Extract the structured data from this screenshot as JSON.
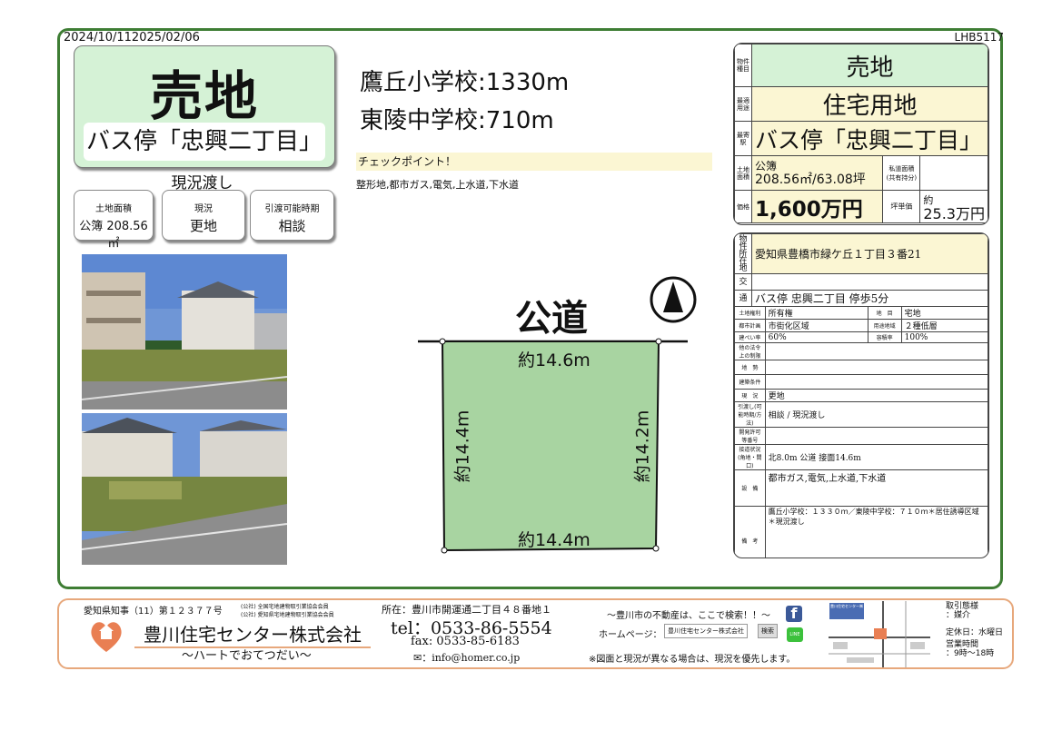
{
  "header": {
    "dates": "2024/10/112025/02/06",
    "code": "LHB5117"
  },
  "title": {
    "type": "売地",
    "bus_stop": "バス停「忠興二丁目」",
    "genkyo": "現況渡し"
  },
  "summary": [
    {
      "label": "土地面積",
      "value": "公簿 208.56㎡"
    },
    {
      "label": "現況",
      "value": "更地"
    },
    {
      "label": "引渡可能時期",
      "value": "相談"
    }
  ],
  "schools": {
    "elementary": "鷹丘小学校:1330m",
    "junior": "東陵中学校:710m"
  },
  "checkpoint": {
    "title": "チェックポイント！",
    "features": "整形地,都市ガス,電気,上水道,下水道"
  },
  "map": {
    "road": "公道",
    "top": "約14.6m",
    "left": "約14.4m",
    "right": "約14.2m",
    "bottom": "約14.4m"
  },
  "info": {
    "k1": "物件種目",
    "type": "売地",
    "k2": "最適用途",
    "use": "住宅用地",
    "k3": "最寄駅",
    "station": "バス停「忠興二丁目」",
    "k4": "土地面積",
    "area_kind": "公簿",
    "area_value": "208.56㎡/63.08坪",
    "private_road_label": "私道面積",
    "private_road_sub": "(共有持分)",
    "k5": "価格",
    "price": "1,600万円",
    "unit_price_label": "坪単価",
    "unit_price_approx": "約",
    "unit_price": "25.3万円",
    "k6": "物件所在地",
    "address": "愛知県豊橋市緑ケ丘１丁目３番21",
    "k7": "交",
    "k8": "通",
    "traffic": "バス停 忠興二丁目 停歩5分",
    "rights_label": "土地権利",
    "rights": "所有権",
    "chimoku_label": "地　目",
    "chimoku": "宅地",
    "city_label": "都市計画",
    "city": "市街化区域",
    "zone_label": "用途地域",
    "zone": "２種低層",
    "bcr_label": "建ぺい率",
    "bcr": "60%",
    "far_label": "容積率",
    "far": "100%",
    "other_law_label": "他の法令上の制限",
    "other_law": "",
    "terrain_label": "地　勢",
    "terrain": "",
    "build_label": "建築条件",
    "build": "",
    "status_label": "現　況",
    "status": "更地",
    "handover_label": "引渡し(可能時期/方法)",
    "handover": "相談 / 現況渡し",
    "dev_label": "開発許可等番号",
    "dev": "",
    "road_label": "接道状況(角地・間口)",
    "road": "北8.0m 公道 接面14.6m",
    "equip_label": "設　備",
    "equip": "都市ガス,電気,上水道,下水道",
    "remarks_label": "備　考",
    "remarks": "鷹丘小学校：１３３０ｍ／東陵中学校：７１０ｍ＊居住誘導区域＊現況渡し"
  },
  "footer": {
    "license": "愛知県知事（11）第１２３７７号",
    "assoc1": "(公社) 全国宅地建物取引業協会会員",
    "assoc2": "(公社) 愛知県宅地建物取引業協会会員",
    "company": "豊川住宅センター株式会社",
    "slogan": "～ハートでおてつだい～",
    "address": "所在：豊川市開運通二丁目４８番地１",
    "tel": "tel：0533-86-5554",
    "fax": "fax: 0533-85-6183",
    "email": "：info@homer.co.jp",
    "search": "～豊川市の不動産は、ここで検索！！～",
    "homepage_label": "ホームページ：",
    "homepage_box": "豊川住宅センター株式会社",
    "search_btn": "検索",
    "line": "LINE",
    "note": "※図面と現況が異なる場合は、現況を優先します。",
    "map_title": "豊川住宅センター㈱",
    "deal_label": "取引態様",
    "deal": "：媒介",
    "holiday": "定休日：水曜日",
    "hours_label": "営業時間",
    "hours": "：9時～18時"
  }
}
